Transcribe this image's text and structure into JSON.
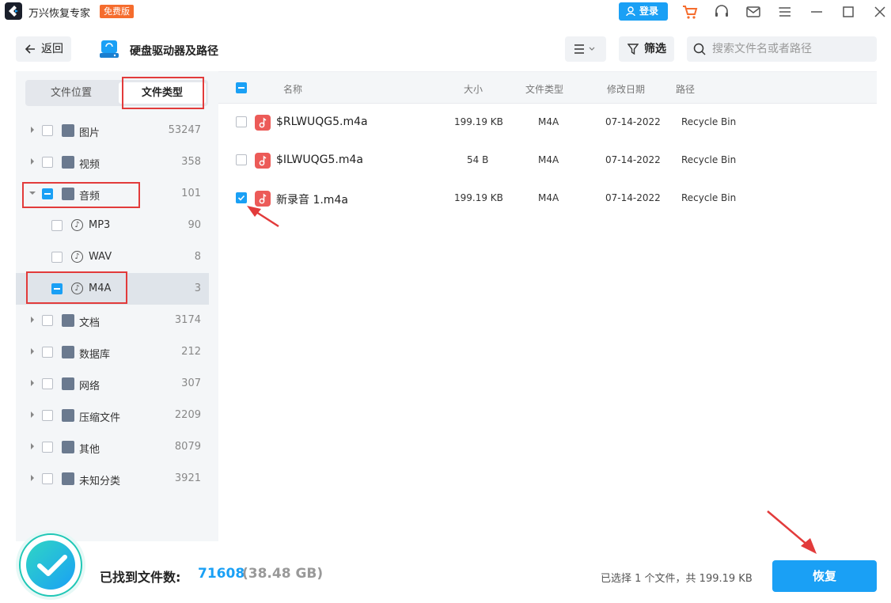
{
  "app": {
    "title": "万兴恢复专家",
    "badge": "免费版",
    "login": "登录"
  },
  "toolbar": {
    "back": "返回",
    "location_title": "硬盘驱动器及路径",
    "filter": "筛选",
    "search_placeholder": "搜索文件名或者路径"
  },
  "tabs": {
    "location": "文件位置",
    "type": "文件类型"
  },
  "tree": [
    {
      "label": "图片",
      "count": "53247"
    },
    {
      "label": "视频",
      "count": "358"
    },
    {
      "label": "音频",
      "count": "101"
    },
    {
      "label": "MP3",
      "count": "90"
    },
    {
      "label": "WAV",
      "count": "8"
    },
    {
      "label": "M4A",
      "count": "3"
    },
    {
      "label": "文档",
      "count": "3174"
    },
    {
      "label": "数据库",
      "count": "212"
    },
    {
      "label": "网络",
      "count": "307"
    },
    {
      "label": "压缩文件",
      "count": "2209"
    },
    {
      "label": "其他",
      "count": "8079"
    },
    {
      "label": "未知分类",
      "count": "3921"
    }
  ],
  "columns": {
    "name": "名称",
    "size": "大小",
    "type": "文件类型",
    "date": "修改日期",
    "path": "路径"
  },
  "files": [
    {
      "name": "$RLWUQG5.m4a",
      "size": "199.19 KB",
      "type": "M4A",
      "date": "07-14-2022",
      "path": "Recycle Bin",
      "checked": false
    },
    {
      "name": "$ILWUQG5.m4a",
      "size": "54 B",
      "type": "M4A",
      "date": "07-14-2022",
      "path": "Recycle Bin",
      "checked": false
    },
    {
      "name": "新录音 1.m4a",
      "size": "199.19 KB",
      "type": "M4A",
      "date": "07-14-2022",
      "path": "Recycle Bin",
      "checked": true
    }
  ],
  "footer": {
    "found_label": "已找到文件数:",
    "found_count": "71608",
    "found_size": "(38.48 GB)",
    "selection": "已选择 1 个文件，共 199.19 KB",
    "recover": "恢复"
  },
  "colors": {
    "accent": "#1aa0f5",
    "badge": "#f56c2d",
    "annotation": "#e23b3b",
    "audio_icon": "#ec5b58"
  }
}
